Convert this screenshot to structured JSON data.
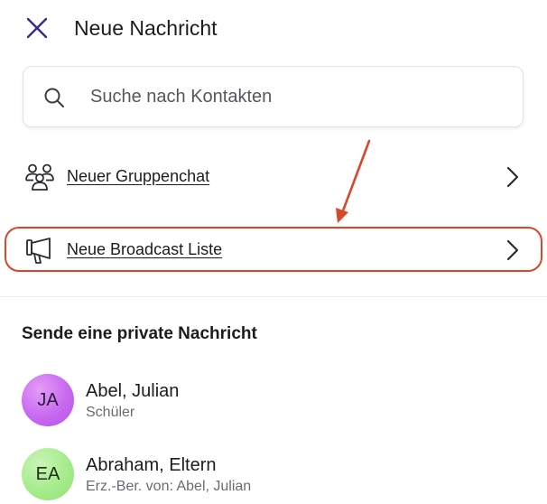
{
  "header": {
    "title": "Neue Nachricht",
    "close_icon": "close-icon"
  },
  "search": {
    "placeholder": "Suche nach Kontakten",
    "value": "",
    "icon": "search-icon"
  },
  "actions": [
    {
      "label": "Neuer Gruppenchat",
      "icon": "group-icon"
    },
    {
      "label": "Neue Broadcast Liste",
      "icon": "megaphone-icon"
    }
  ],
  "section": {
    "title": "Sende eine private Nachricht"
  },
  "contacts": [
    {
      "initials": "JA",
      "name": "Abel, Julian",
      "subtitle": "Schüler"
    },
    {
      "initials": "EA",
      "name": "Abraham, Eltern",
      "subtitle": "Erz.-Ber. von: Abel, Julian"
    }
  ],
  "colors": {
    "accent": "#3a2a8c",
    "highlight": "#d9472b",
    "avatar_ja": "#c869f0",
    "avatar_ea": "#a6eb8c"
  }
}
